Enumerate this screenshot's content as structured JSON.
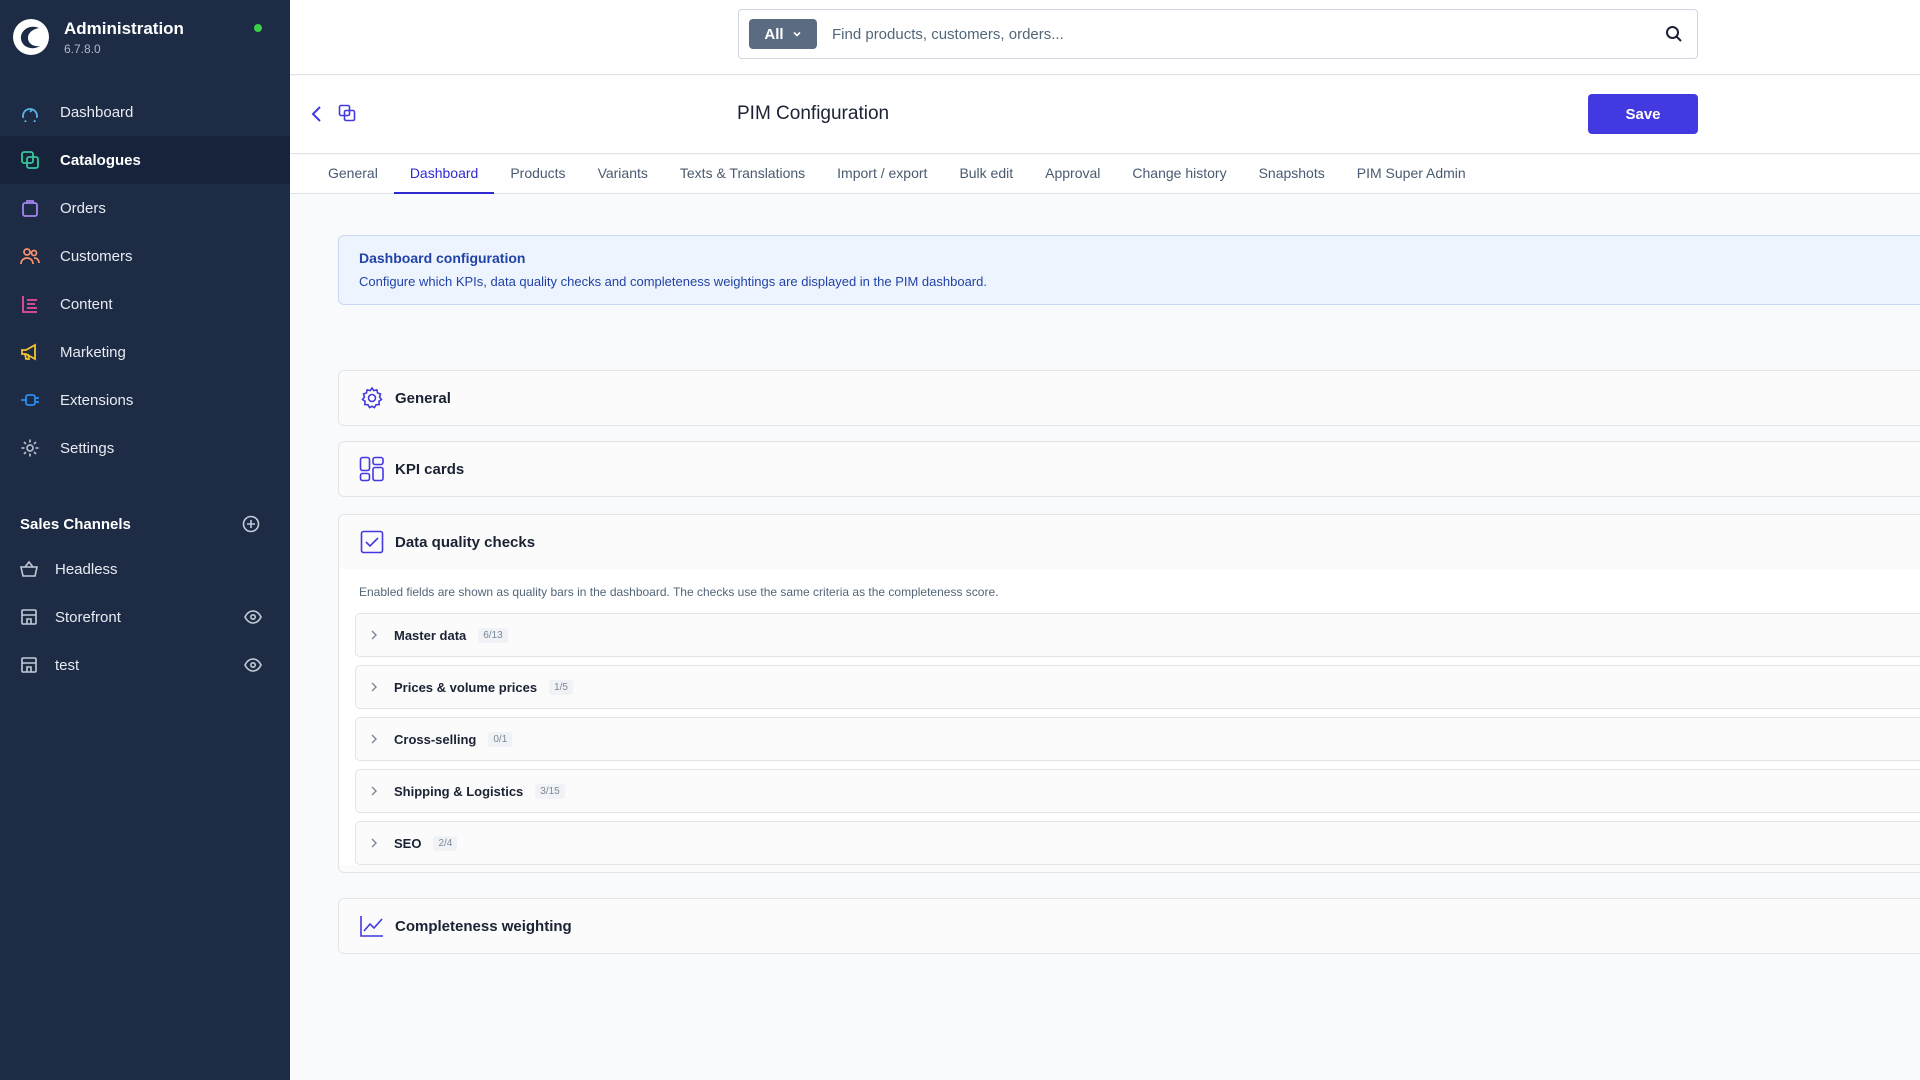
{
  "brand": {
    "title": "Administration",
    "version": "6.7.8.0"
  },
  "nav": {
    "items": [
      {
        "label": "Dashboard",
        "icon": "dashboard-icon",
        "color": "#5ab4e8"
      },
      {
        "label": "Catalogues",
        "icon": "catalogue-icon",
        "color": "#36c79a"
      },
      {
        "label": "Orders",
        "icon": "shopping-bag-icon",
        "color": "#a586f0"
      },
      {
        "label": "Customers",
        "icon": "users-icon",
        "color": "#f6906a"
      },
      {
        "label": "Content",
        "icon": "content-icon",
        "color": "#ea4c9c"
      },
      {
        "label": "Marketing",
        "icon": "megaphone-icon",
        "color": "#f2c230"
      },
      {
        "label": "Extensions",
        "icon": "plug-icon",
        "color": "#2b8ff0"
      },
      {
        "label": "Settings",
        "icon": "gear-icon",
        "color": "#aeb8c8"
      }
    ],
    "active": "Catalogues"
  },
  "sales_channels": {
    "title": "Sales Channels",
    "items": [
      {
        "label": "Headless",
        "icon": "basket-icon",
        "visibility_toggle": false
      },
      {
        "label": "Storefront",
        "icon": "storefront-icon",
        "visibility_toggle": true
      },
      {
        "label": "test",
        "icon": "storefront-icon",
        "visibility_toggle": true
      }
    ]
  },
  "search": {
    "scope": "All",
    "placeholder": "Find products, customers, orders..."
  },
  "header": {
    "title": "PIM Configuration",
    "save_label": "Save"
  },
  "tabs": {
    "items": [
      "General",
      "Dashboard",
      "Products",
      "Variants",
      "Texts & Translations",
      "Import / export",
      "Bulk edit",
      "Approval",
      "Change history",
      "Snapshots",
      "PIM Super Admin"
    ],
    "active": "Dashboard"
  },
  "info": {
    "title": "Dashboard configuration",
    "text": "Configure which KPIs, data quality checks and completeness weightings are displayed in the PIM dashboard."
  },
  "sections": {
    "general": "General",
    "kpi": "KPI cards",
    "data_quality": "Data quality checks",
    "completeness": "Completeness weighting"
  },
  "data_quality": {
    "description": "Enabled fields are shown as quality bars in the dashboard. The checks use the same criteria as the completeness score.",
    "groups": [
      {
        "label": "Master data",
        "count": "6/13"
      },
      {
        "label": "Prices & volume prices",
        "count": "1/5"
      },
      {
        "label": "Cross-selling",
        "count": "0/1"
      },
      {
        "label": "Shipping & Logistics",
        "count": "3/15"
      },
      {
        "label": "SEO",
        "count": "2/4"
      }
    ]
  },
  "colors": {
    "sidebar_bg": "#1d2b44",
    "accent": "#4339e0",
    "info_text": "#2143a8",
    "status_online": "#37d046"
  }
}
